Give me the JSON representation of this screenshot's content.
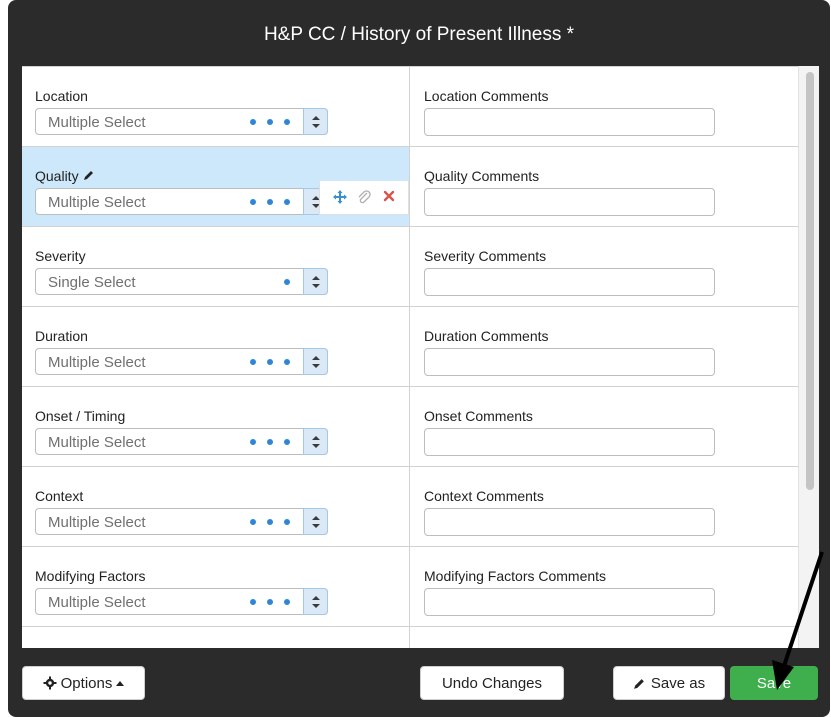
{
  "title": "H&P CC / History of Present Illness *",
  "rows": [
    {
      "label": "Location",
      "select_placeholder": "Multiple Select",
      "dots": 3,
      "comment_label": "Location Comments"
    },
    {
      "label": "Quality",
      "select_placeholder": "Multiple Select",
      "dots": 3,
      "comment_label": "Quality Comments",
      "selected": true
    },
    {
      "label": "Severity",
      "select_placeholder": "Single Select",
      "dots": 1,
      "comment_label": "Severity Comments"
    },
    {
      "label": "Duration",
      "select_placeholder": "Multiple Select",
      "dots": 3,
      "comment_label": "Duration Comments"
    },
    {
      "label": "Onset / Timing",
      "select_placeholder": "Multiple Select",
      "dots": 3,
      "comment_label": "Onset Comments"
    },
    {
      "label": "Context",
      "select_placeholder": "Multiple Select",
      "dots": 3,
      "comment_label": "Context Comments"
    },
    {
      "label": "Modifying Factors",
      "select_placeholder": "Multiple Select",
      "dots": 3,
      "comment_label": "Modifying Factors Comments"
    }
  ],
  "footer": {
    "options_label": "Options",
    "undo_label": "Undo Changes",
    "save_as_label": "Save as",
    "save_label": "Save"
  },
  "colors": {
    "modal_bg": "#2b2b2b",
    "selected_row_bg": "#cde8fb",
    "dot_blue": "#2f86d6",
    "save_green": "#3fae4c",
    "delete_red": "#d9534f"
  },
  "icons": {
    "edit": "pencil-icon",
    "move": "move-icon",
    "attach": "paperclip-icon",
    "delete": "close-icon",
    "options": "gear-icon",
    "options_caret": "caret-up-icon",
    "save_as": "pencil-icon",
    "select_toggle": "up-down-arrows-icon"
  }
}
